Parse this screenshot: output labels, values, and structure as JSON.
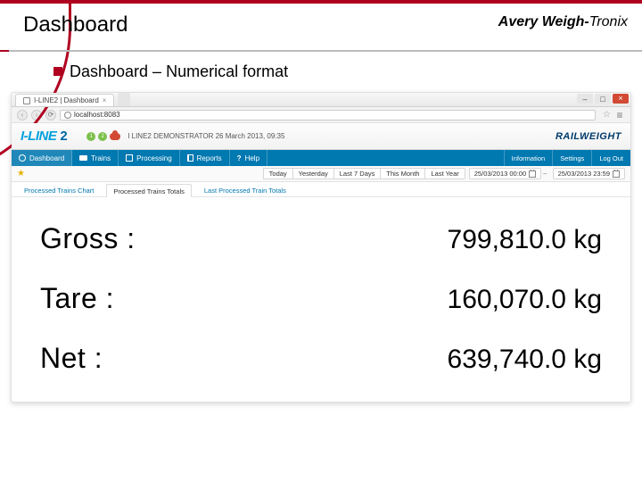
{
  "slide": {
    "title": "Dashboard",
    "subtitle": "Dashboard – Numerical format",
    "brand_main": "Avery Weigh-",
    "brand_suffix": "Tronix"
  },
  "browser": {
    "tab_title": "I-LINE2 | Dashboard",
    "address": "localhost:8083"
  },
  "app": {
    "logo_main": "I-LINE",
    "logo_two": "2",
    "status_numbers": [
      "1",
      "2"
    ],
    "subtitle": "I LINE2 DEMONSTRATOR   26 March 2013, 09:35",
    "railweight": "RAILWEIGHT"
  },
  "nav": {
    "items": [
      {
        "label": "Dashboard"
      },
      {
        "label": "Trains"
      },
      {
        "label": "Processing"
      },
      {
        "label": "Reports"
      },
      {
        "label": "Help"
      }
    ],
    "right": [
      {
        "label": "Information"
      },
      {
        "label": "Settings"
      },
      {
        "label": "Log Out"
      }
    ]
  },
  "filters": {
    "chips": [
      "Today",
      "Yesterday",
      "Last 7 Days",
      "This Month",
      "Last Year"
    ],
    "from": "25/03/2013 00:00",
    "to": "25/03/2013 23:59"
  },
  "subtabs": {
    "items": [
      "Processed Trains Chart",
      "Processed Trains Totals",
      "Last Processed Train Totals"
    ],
    "active_index": 1
  },
  "totals": [
    {
      "label": "Gross :",
      "value": "799,810.0 kg"
    },
    {
      "label": "Tare :",
      "value": "160,070.0 kg"
    },
    {
      "label": "Net :",
      "value": "639,740.0 kg"
    }
  ]
}
